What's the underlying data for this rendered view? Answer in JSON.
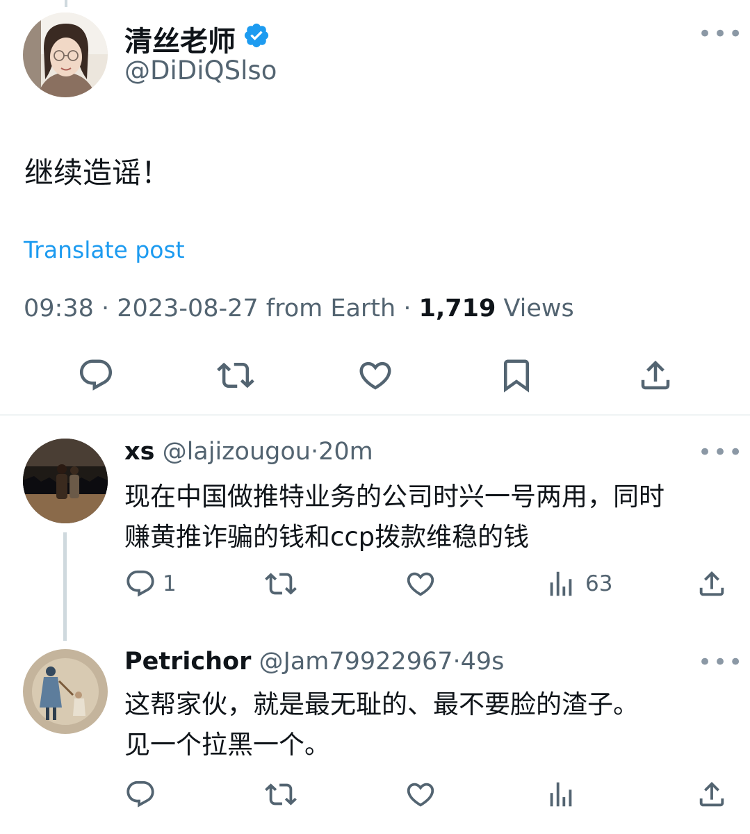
{
  "main_post": {
    "author_name": "清丝老师",
    "verified": true,
    "handle": "@DiDiQSlso",
    "text": "继续造谣！",
    "translate_label": "Translate post",
    "timestamp": "09:38 · 2023-08-27 from Earth",
    "separator": " · ",
    "views_count": "1,719",
    "views_label": "Views",
    "actions": [
      "reply-icon",
      "repost-icon",
      "like-icon",
      "bookmark-icon",
      "share-icon"
    ]
  },
  "replies": [
    {
      "author_name": "xs",
      "handle": "@lajizougou",
      "time": "·20m",
      "text_line1": "现在中国做推特业务的公司时兴一号两用，同时",
      "text_line2": "赚黄推诈骗的钱和ccp拨款维稳的钱",
      "reply_count": "1",
      "repost_count": "",
      "like_count": "",
      "views_count": "63"
    },
    {
      "author_name": "Petrichor",
      "handle": "@Jam79922967",
      "time": "·49s",
      "text_line1": "这帮家伙，就是最无耻的、最不要脸的渣子。",
      "text_line2": "见一个拉黑一个。",
      "reply_count": "",
      "repost_count": "",
      "like_count": "",
      "views_count": ""
    }
  ],
  "colors": {
    "link": "#1d9bf0",
    "secondary_text": "#536471",
    "icon": "#536471",
    "divider": "#eff3f4",
    "thread_line": "#cfd9de"
  }
}
